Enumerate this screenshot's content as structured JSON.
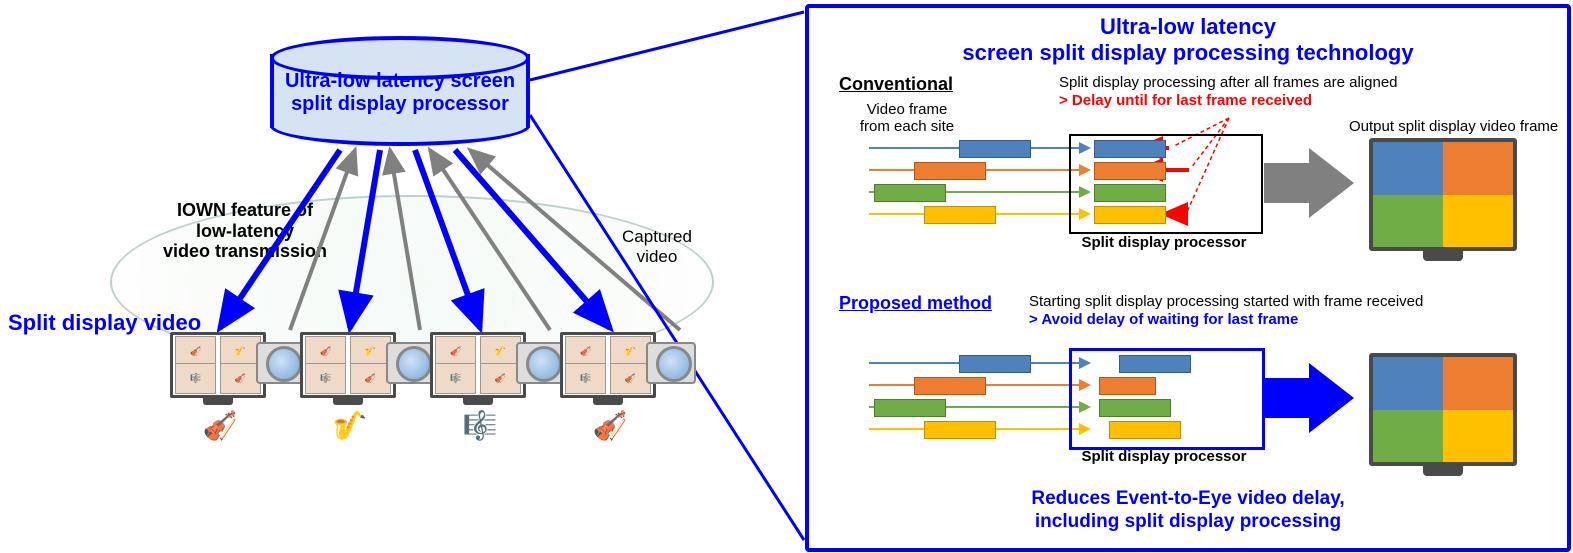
{
  "left": {
    "processor_label": "Ultra-low latency\nscreen split display\nprocessor",
    "iown": "IOWN feature of\nlow-latency\nvideo transmission",
    "captured": "Captured\nvideo",
    "split_video": "Split display video",
    "performers": [
      "🎻",
      "🎷",
      "🎼",
      "🎻"
    ]
  },
  "panel": {
    "title": "Ultra-low latency\nscreen split display processing technology",
    "conventional": "Conventional",
    "conv_left": "Video frame\nfrom each site",
    "conv_note1": "Split display processing after all frames are aligned",
    "conv_note2": "> Delay until for last frame received",
    "conv_out": "Output split display video frame",
    "sdp": "Split display processor",
    "proposed": "Proposed method",
    "prop_note1": "Starting split display processing started with frame received",
    "prop_note2": "> Avoid delay of waiting for last frame",
    "bottom": "Reduces Event-to-Eye video delay,\nincluding split display processing"
  },
  "colors": {
    "blue": "#4f81bd",
    "orange": "#ed7d31",
    "green": "#70ad47",
    "yellow": "#ffc000",
    "arrow_blue": "#0000ff",
    "arrow_red": "#ff0000"
  }
}
